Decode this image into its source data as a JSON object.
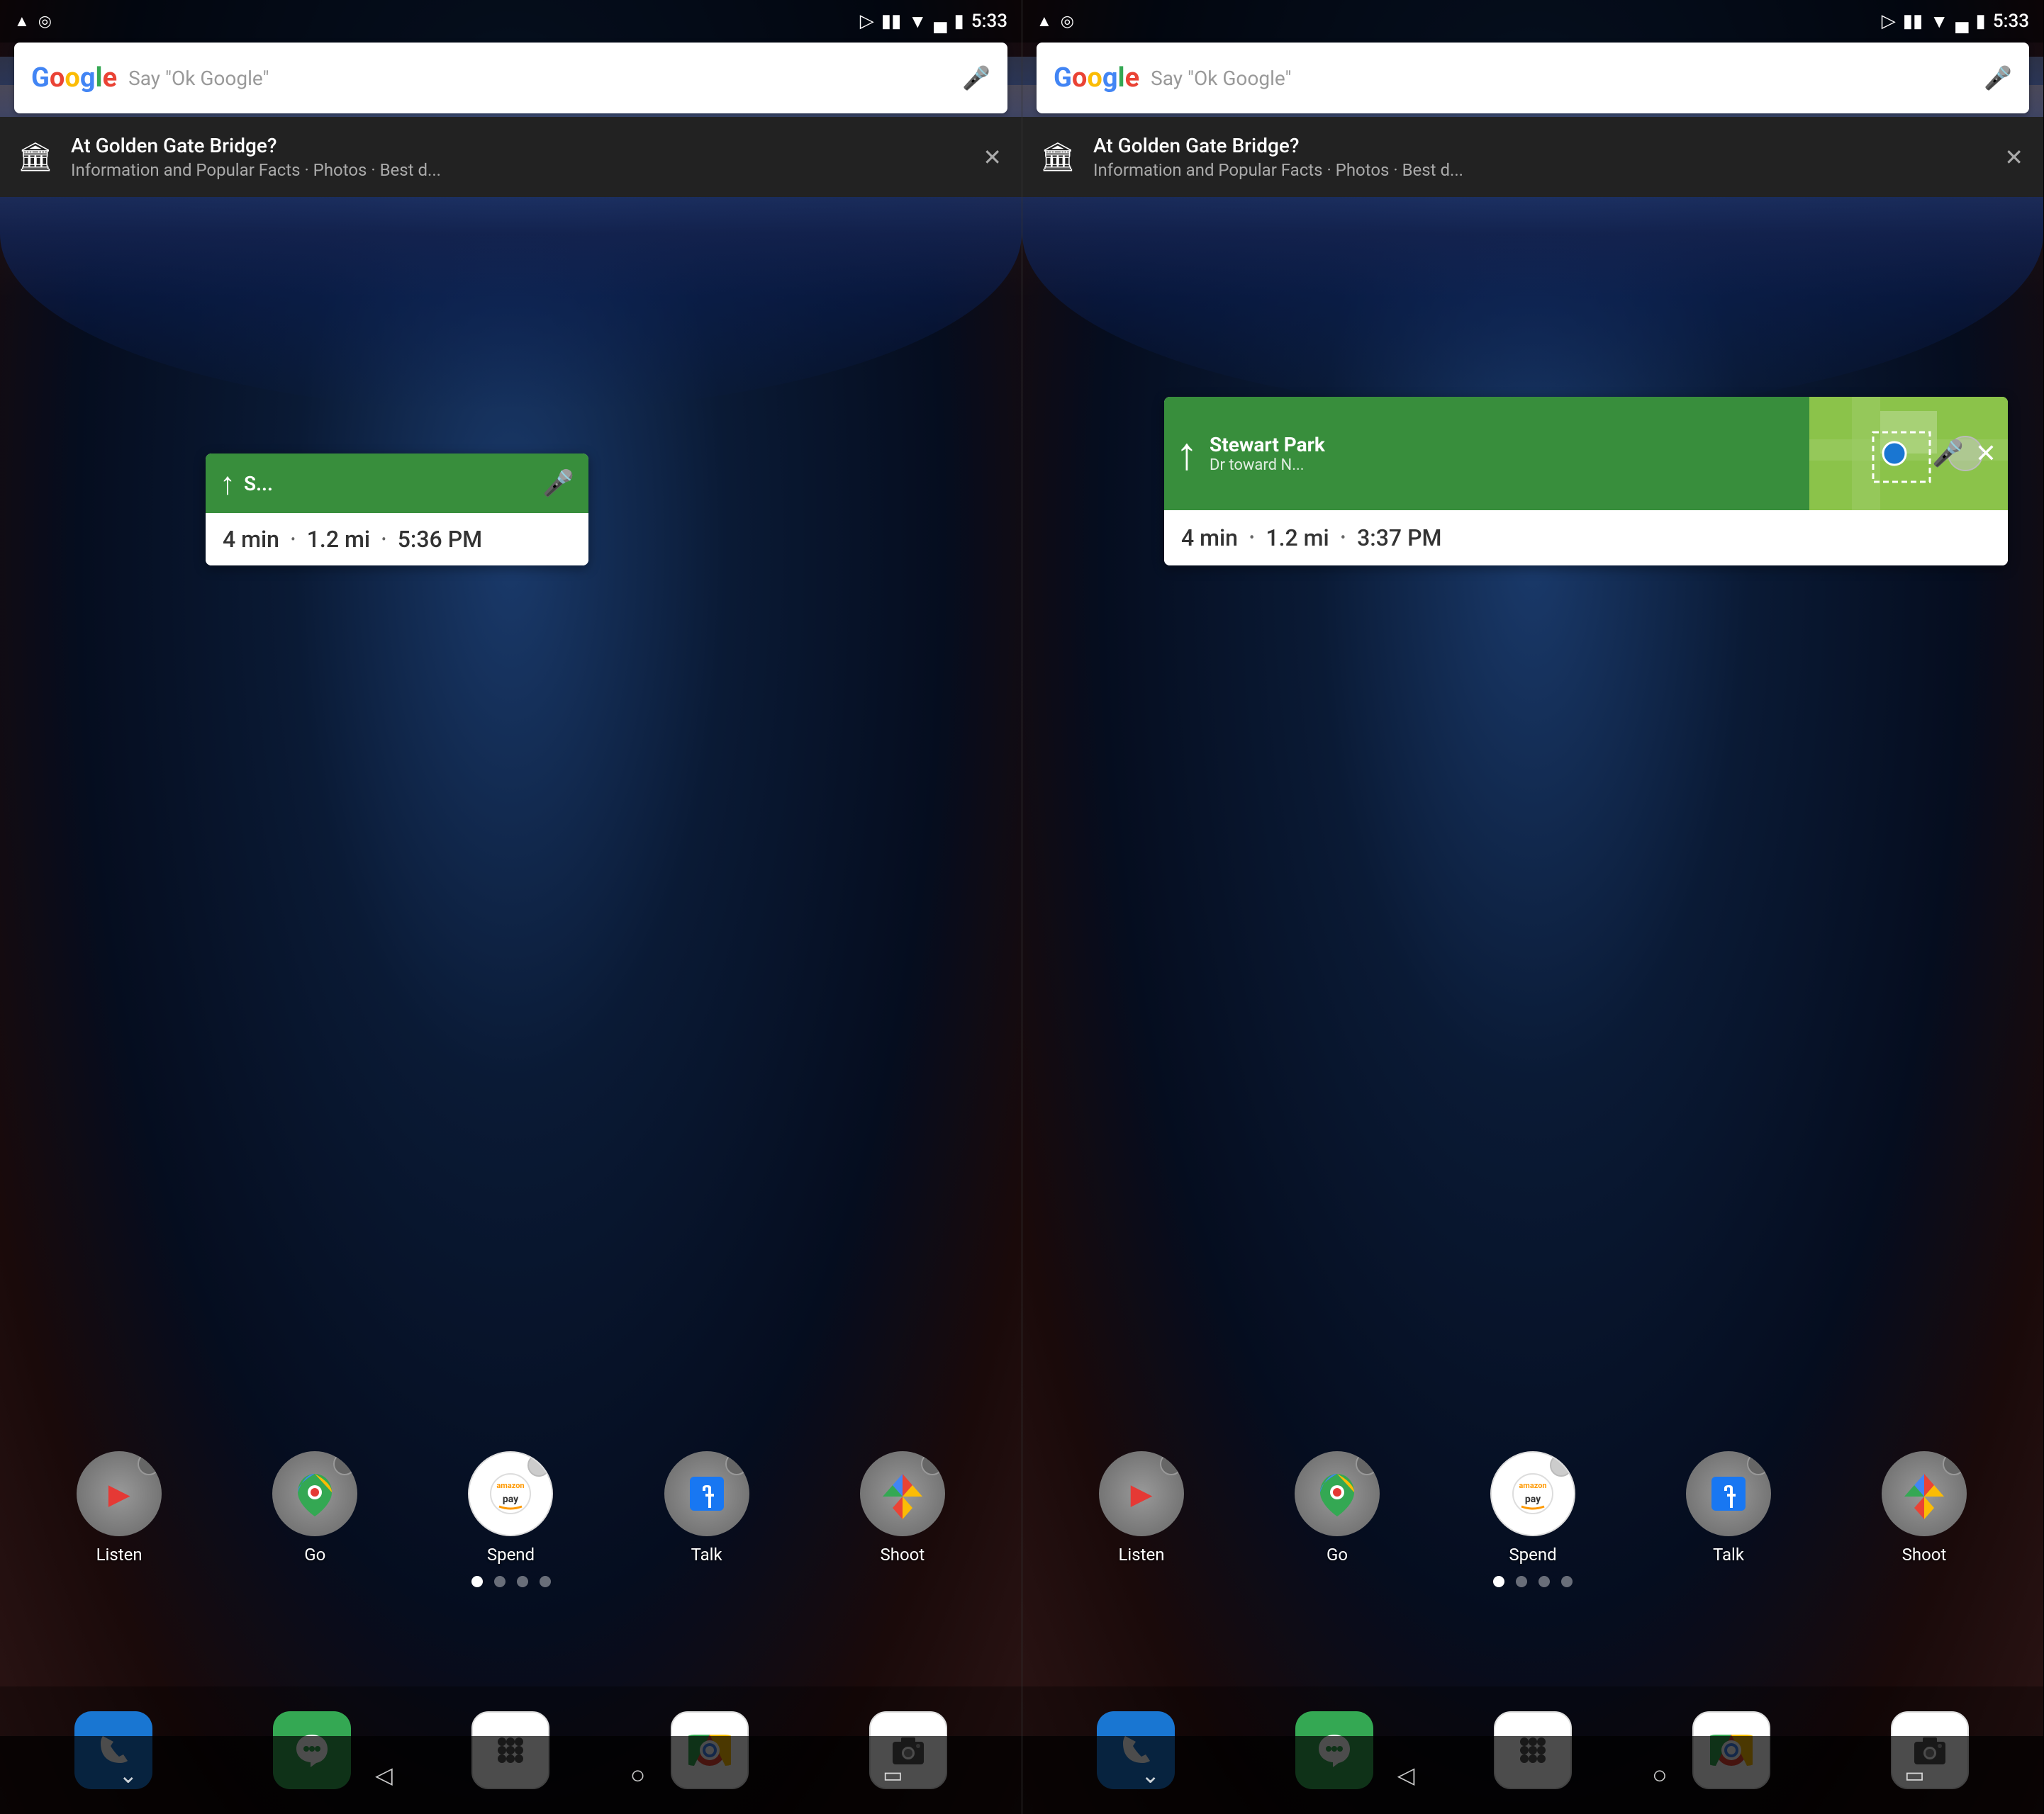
{
  "screens": [
    {
      "id": "left",
      "statusBar": {
        "time": "5:33",
        "leftIcons": [
          "nav-arrow",
          "location-circle"
        ]
      },
      "searchBar": {
        "logo": "Google",
        "placeholder": "Say \"Ok Google\"",
        "hasMic": true
      },
      "notification": {
        "title": "At Golden Gate Bridge?",
        "subtitle": "Information and Popular Facts · Photos · Best d..."
      },
      "navWidget": {
        "topText": "S...",
        "time": "5:36 PM",
        "distance": "1.2 mi",
        "duration": "4 min"
      },
      "apps": [
        {
          "label": "Listen",
          "icon": "youtube-music"
        },
        {
          "label": "Go",
          "icon": "google-maps"
        },
        {
          "label": "Spend",
          "icon": "amazon-pay"
        },
        {
          "label": "Talk",
          "icon": "facebook"
        },
        {
          "label": "Shoot",
          "icon": "google-photos"
        }
      ],
      "dockApps": [
        {
          "icon": "phone",
          "bg": "#1976D2"
        },
        {
          "icon": "hangouts",
          "bg": "#34A853"
        },
        {
          "icon": "apps-grid",
          "bg": "#fff"
        },
        {
          "icon": "chrome",
          "bg": "#fff"
        },
        {
          "icon": "camera",
          "bg": "#fff"
        }
      ],
      "pageIndicator": {
        "dots": 4,
        "active": 0
      }
    },
    {
      "id": "right",
      "statusBar": {
        "time": "5:33",
        "leftIcons": [
          "nav-arrow",
          "location-circle"
        ]
      },
      "searchBar": {
        "logo": "Google",
        "placeholder": "Say \"Ok Google\"",
        "hasMic": true
      },
      "notification": {
        "title": "At Golden Gate Bridge?",
        "subtitle": "Information and Popular Facts · Photos · Best d..."
      },
      "navWidget": {
        "locationName": "Stewart Park",
        "toward": "Dr toward N...",
        "time": "3:37 PM",
        "distance": "1.2 mi",
        "duration": "4 min"
      },
      "apps": [
        {
          "label": "Listen",
          "icon": "youtube-music"
        },
        {
          "label": "Go",
          "icon": "google-maps"
        },
        {
          "label": "Spend",
          "icon": "amazon-pay"
        },
        {
          "label": "Talk",
          "icon": "facebook"
        },
        {
          "label": "Shoot",
          "icon": "google-photos"
        }
      ],
      "dockApps": [
        {
          "icon": "phone",
          "bg": "#1976D2"
        },
        {
          "icon": "hangouts",
          "bg": "#34A853"
        },
        {
          "icon": "apps-grid",
          "bg": "#fff"
        },
        {
          "icon": "chrome",
          "bg": "#fff"
        },
        {
          "icon": "camera",
          "bg": "#fff"
        }
      ],
      "pageIndicator": {
        "dots": 4,
        "active": 0
      }
    }
  ],
  "labels": {
    "listen": "Listen",
    "go": "Go",
    "spend": "Spend",
    "talk": "Talk",
    "shoot": "Shoot",
    "nav_close": "×",
    "nav_4min": "4 min",
    "nav_12mi": "1.2 mi",
    "nav_time_left": "5:36 PM",
    "nav_time_right": "3:37 PM",
    "notif_title": "At Golden Gate Bridge?",
    "notif_sub": "Information and Popular Facts · Photos · Best d...",
    "search_placeholder": "Say \"Ok Google\"",
    "stewart_park": "Stewart Park",
    "toward": "Dr toward N...",
    "time": "5:33"
  }
}
